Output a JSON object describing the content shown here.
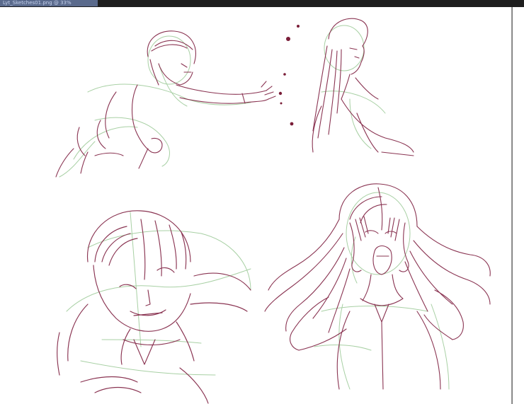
{
  "window": {
    "document_tab_label": "Lyt_Sketches01.png @ 33%",
    "ink_color": "#8a3452",
    "guide_color": "#9cc89a",
    "canvas_color": "#ffffff"
  },
  "canvas": {
    "sketches": [
      {
        "name": "sketch-reaching-man"
      },
      {
        "name": "sketch-long-hair-profile"
      },
      {
        "name": "sketch-grinning-man-closeup"
      },
      {
        "name": "sketch-screaming-woman"
      }
    ]
  }
}
